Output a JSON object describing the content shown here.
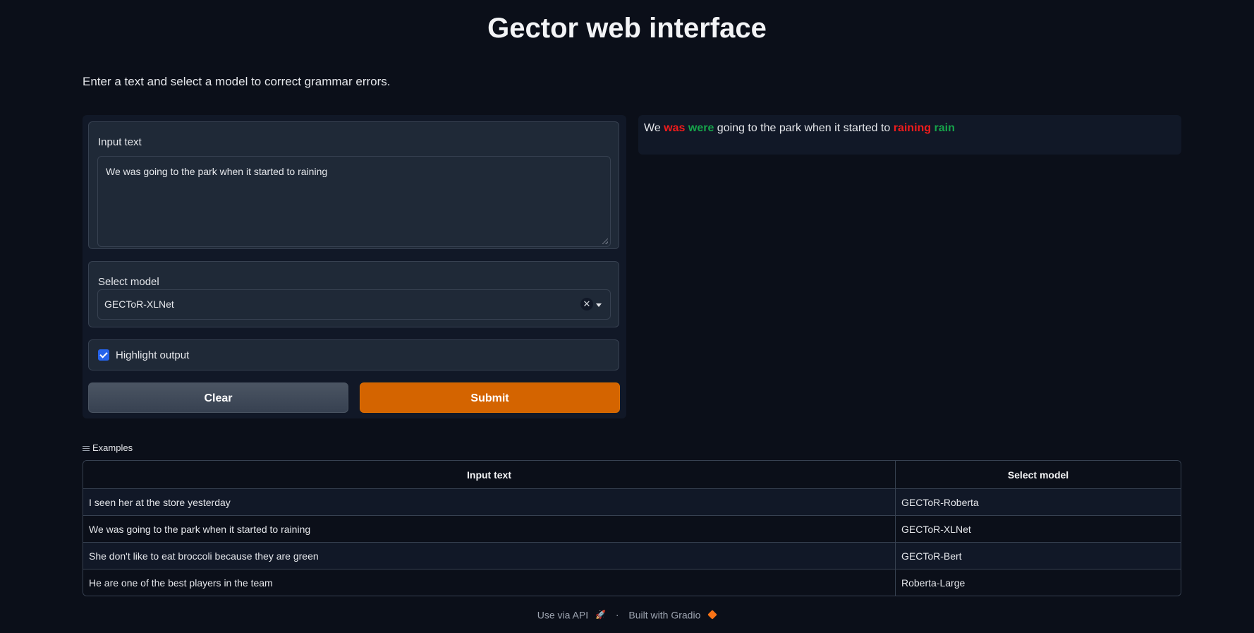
{
  "header": {
    "title": "Gector web interface",
    "description": "Enter a text and select a model to correct grammar errors."
  },
  "form": {
    "input_label": "Input text",
    "input_value": "We was going to the park when it started to raining",
    "model_label": "Select model",
    "model_value": "GECToR-XLNet",
    "highlight_label": "Highlight output",
    "highlight_checked": true,
    "clear_label": "Clear",
    "submit_label": "Submit"
  },
  "output": {
    "tokens": [
      {
        "text": "We",
        "type": "normal"
      },
      {
        "text": "was",
        "type": "deleted"
      },
      {
        "text": "were",
        "type": "inserted"
      },
      {
        "text": "going to the park when it started to",
        "type": "normal"
      },
      {
        "text": "raining",
        "type": "deleted"
      },
      {
        "text": "rain",
        "type": "inserted"
      }
    ],
    "colors": {
      "deleted": "#ef1c1c",
      "inserted": "#16a34a"
    }
  },
  "examples": {
    "label": "Examples",
    "columns": [
      "Input text",
      "Select model"
    ],
    "rows": [
      [
        "I seen her at the store yesterday",
        "GECToR-Roberta"
      ],
      [
        "We was going to the park when it started to raining",
        "GECToR-XLNet"
      ],
      [
        "She don't like to eat broccoli because they are green",
        "GECToR-Bert"
      ],
      [
        "He are one of the best players in the team",
        "Roberta-Large"
      ]
    ]
  },
  "footer": {
    "api_label": "Use via API",
    "separator": "·",
    "built_label": "Built with Gradio"
  },
  "theme": {
    "background": "#0b0f19",
    "accent": "#d46400",
    "checkbox": "#2563eb"
  }
}
